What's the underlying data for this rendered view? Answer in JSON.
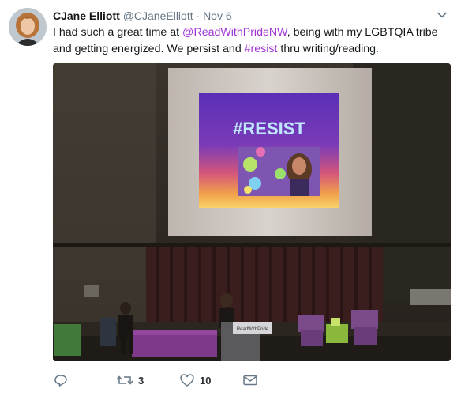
{
  "tweet": {
    "author": {
      "name": "CJane Elliott",
      "handle": "@CJaneElliott",
      "separator": "·",
      "time": "Nov 6"
    },
    "text": {
      "part1": "I had such a great time at ",
      "mention": "@ReadWithPrideNW",
      "part2": ", being with my LGBTQIA tribe and getting energized. We persist and ",
      "hashtag": "#resist",
      "part3": " thru writing/reading."
    },
    "media": {
      "slide_text": "#RESIST",
      "podium_text": "ReadWithPride"
    },
    "actions": {
      "retweets": "3",
      "likes": "10"
    }
  },
  "colors": {
    "link": "#a033d6",
    "muted": "#657786",
    "text": "#14171a"
  },
  "icons": [
    "chevron-down-icon",
    "reply-icon",
    "retweet-icon",
    "heart-icon",
    "mail-icon"
  ]
}
